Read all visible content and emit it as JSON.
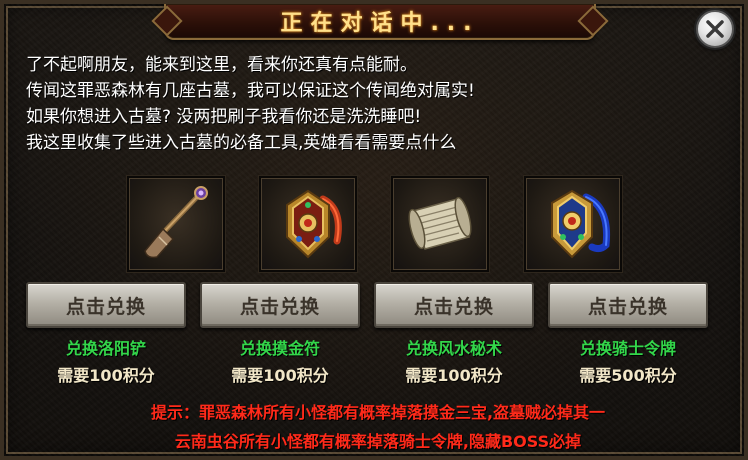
{
  "dialog": {
    "title": "正在对话中...",
    "close_icon": "close-icon",
    "message_lines": [
      "了不起啊朋友，能来到这里，看来你还真有点能耐。",
      "传闻这罪恶森林有几座古墓，我可以保证这个传闻绝对属实!",
      "如果你想进入古墓? 没两把刷子我看你还是洗洗睡吧!",
      "我这里收集了些进入古墓的必备工具,英雄看看需要点什么"
    ]
  },
  "items": [
    {
      "icon": "shovel-icon",
      "button_label": "点击兑换",
      "name": "兑换洛阳铲",
      "cost": "需要100积分"
    },
    {
      "icon": "gold-talisman-icon",
      "button_label": "点击兑换",
      "name": "兑换摸金符",
      "cost": "需要100积分"
    },
    {
      "icon": "scroll-icon",
      "button_label": "点击兑换",
      "name": "兑换风水秘术",
      "cost": "需要100积分"
    },
    {
      "icon": "knight-token-icon",
      "button_label": "点击兑换",
      "name": "兑换骑士令牌",
      "cost": "需要500积分"
    }
  ],
  "tips": [
    "提示：罪恶森林所有小怪都有概率掉落摸金三宝,盗墓贼必掉其一",
    "云南虫谷所有小怪都有概率掉落骑士令牌,隐藏BOSS必掉"
  ],
  "colors": {
    "title": "#ffe08a",
    "item_name": "#33d64a",
    "tip": "#ff2a1a"
  }
}
